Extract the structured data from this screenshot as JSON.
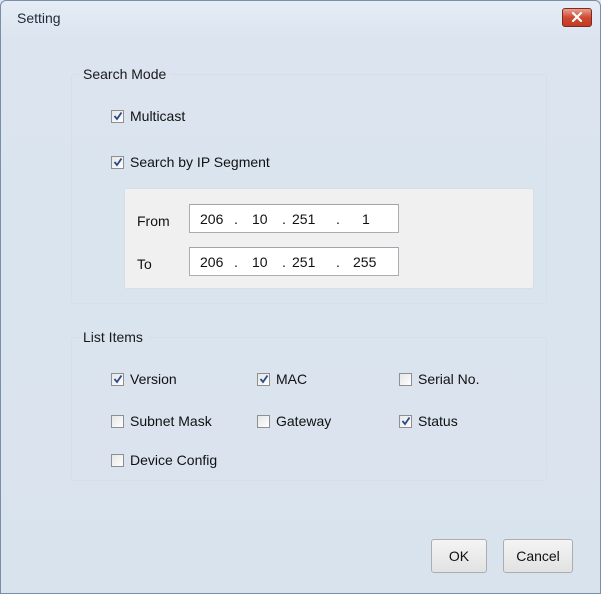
{
  "window": {
    "title": "Setting"
  },
  "search_mode": {
    "legend": "Search Mode",
    "multicast": {
      "label": "Multicast",
      "checked": true
    },
    "ip_segment": {
      "label": "Search by IP Segment",
      "checked": true
    },
    "from": {
      "label": "From",
      "octets": [
        "206",
        "10",
        "251",
        "1"
      ]
    },
    "to": {
      "label": "To",
      "octets": [
        "206",
        "10",
        "251",
        "255"
      ]
    }
  },
  "list_items": {
    "legend": "List Items",
    "items": [
      {
        "label": "Version",
        "checked": true
      },
      {
        "label": "MAC",
        "checked": true
      },
      {
        "label": "Serial No.",
        "checked": false
      },
      {
        "label": "Subnet Mask",
        "checked": false
      },
      {
        "label": "Gateway",
        "checked": false
      },
      {
        "label": "Status",
        "checked": true
      },
      {
        "label": "Device Config",
        "checked": false
      }
    ]
  },
  "buttons": {
    "ok": "OK",
    "cancel": "Cancel"
  },
  "icons": {
    "close": "close-icon",
    "check": "checkmark-icon"
  },
  "colors": {
    "close_button": "#c94a34",
    "checkmark": "#2b4a8a"
  }
}
